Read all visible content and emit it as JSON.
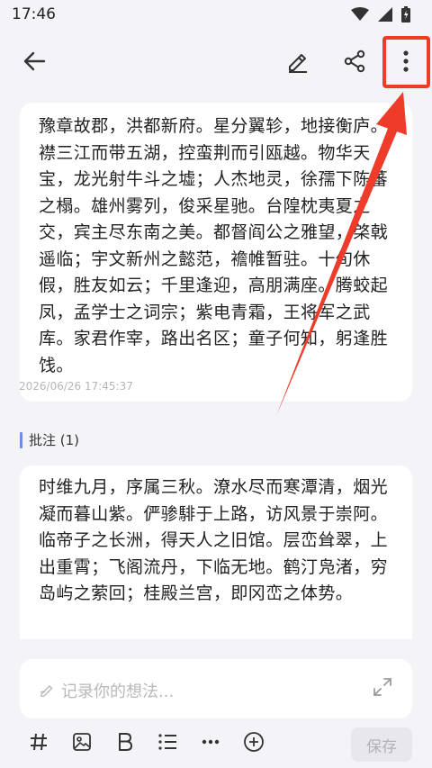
{
  "status_bar": {
    "time": "17:46"
  },
  "top_bar": {
    "back_icon": "arrow-left-icon",
    "edit_icon": "pencil-icon",
    "share_icon": "share-icon",
    "more_icon": "more-vertical-icon"
  },
  "note": {
    "text": "豫章故郡，洪都新府。星分翼轸，地接衡庐。襟三江而带五湖，控蛮荆而引瓯越。物华天宝，龙光射牛斗之墟；人杰地灵，徐孺下陈蕃之榻。雄州雾列，俊采星驰。台隍枕夷夏之交，宾主尽东南之美。都督阎公之雅望，棨戟遥临；宇文新州之懿范，襜帷暂驻。十旬休假，胜友如云；千里逢迎，高朋满座。腾蛟起凤，孟学士之词宗；紫电青霜，王将军之武库。家君作宰，路出名区；童子何知，躬逢胜饯。",
    "timestamp": "2026/06/26 17:45:37"
  },
  "annotations": {
    "label": "批注 (1)",
    "items": [
      {
        "text": "时维九月，序属三秋。潦水尽而寒潭清，烟光凝而暮山紫。俨骖騑于上路，访风景于崇阿。临帝子之长洲，得天人之旧馆。层峦耸翠，上出重霄；飞阁流丹，下临无地。鹤汀凫渚，穷岛屿之萦回；桂殿兰宫，即冈峦之体势。"
      }
    ]
  },
  "composer": {
    "placeholder": "记录你的想法...",
    "save_label": "保存",
    "tools": [
      "hash-icon",
      "image-icon",
      "bold-icon",
      "list-icon",
      "more-horizontal-icon",
      "add-circle-icon"
    ]
  },
  "colors": {
    "highlight": "#ee3b2a",
    "annotation_accent": "#6a8de8"
  }
}
